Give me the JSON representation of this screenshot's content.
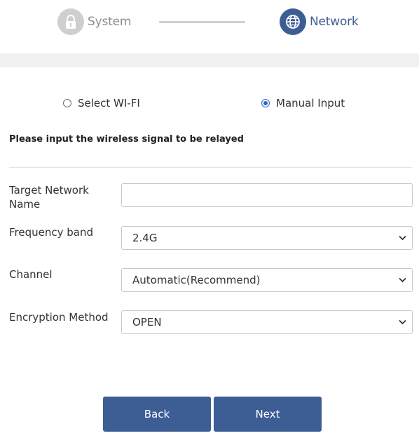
{
  "steps": [
    {
      "label": "System",
      "icon": "lock-icon",
      "state": "inactive"
    },
    {
      "label": "Network",
      "icon": "globe-icon",
      "state": "active"
    }
  ],
  "colors": {
    "accent": "#3d5e94",
    "inactive": "#cfcfcf",
    "radio_checked": "#2a64c4"
  },
  "mode": {
    "options": [
      {
        "label": "Select WI-FI",
        "selected": false
      },
      {
        "label": "Manual Input",
        "selected": true
      }
    ]
  },
  "instruction": "Please input the wireless signal to be relayed",
  "form": {
    "target_network": {
      "label": "Target Network Name",
      "value": "",
      "placeholder": ""
    },
    "frequency_band": {
      "label": "Frequency band",
      "value": "2.4G"
    },
    "channel": {
      "label": "Channel",
      "value": "Automatic(Recommend)"
    },
    "encryption": {
      "label": "Encryption Method",
      "value": "OPEN"
    }
  },
  "buttons": {
    "back": "Back",
    "next": "Next"
  }
}
